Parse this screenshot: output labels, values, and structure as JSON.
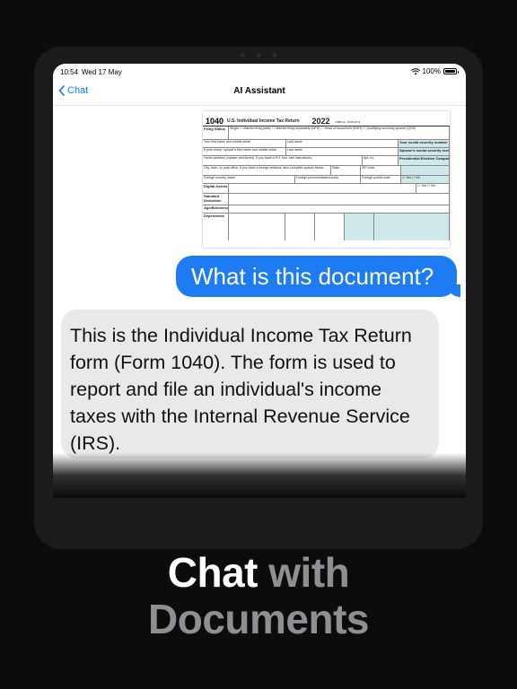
{
  "status_bar": {
    "time": "10:54",
    "date": "Wed 17 May",
    "battery": "100%"
  },
  "nav": {
    "back_label": "Chat",
    "title": "AI Assistant"
  },
  "document_preview": {
    "form_number": "1040",
    "form_title": "U.S. Individual Income Tax Return",
    "year": "2022",
    "omb": "OMB No. 1545-0074",
    "filing_status_label": "Filing Status",
    "filing_status_options": [
      "Single",
      "Married filing jointly",
      "Married filing separately (MFS)",
      "Head of household (HOH)",
      "Qualifying surviving spouse (QSS)"
    ],
    "fields": [
      "Your first name and middle initial",
      "Last name",
      "Your social security number",
      "If joint return, spouse's first name and middle initial",
      "Last name",
      "Spouse's social security number",
      "Home address (number and street). If you have a P.O. box, see instructions.",
      "Apt. no.",
      "Presidential Election Campaign",
      "City, town, or post office. If you have a foreign address, also complete spaces below.",
      "State",
      "ZIP code",
      "Foreign country name",
      "Foreign province/state/county",
      "Foreign postal code"
    ],
    "digital_assets_label": "Digital Assets",
    "standard_deduction_label": "Standard Deduction",
    "age_blindness_label": "Age/Blindness",
    "dependents_label": "Dependents",
    "yes": "Yes",
    "no": "No"
  },
  "messages": {
    "user": "What is this document?",
    "assistant": "This is the Individual Income Tax Return form (Form 1040). The form is used to report and file an individual's income taxes with the Internal Revenue Service (IRS)."
  },
  "caption": {
    "line1_white": "Chat",
    "line1_gray": "with",
    "line2_gray": "Documents"
  },
  "colors": {
    "accent": "#1e7cf2",
    "bubble_gray": "#e9e9eb",
    "background": "#0c0c0c",
    "caption_gray": "#8e8e93"
  }
}
